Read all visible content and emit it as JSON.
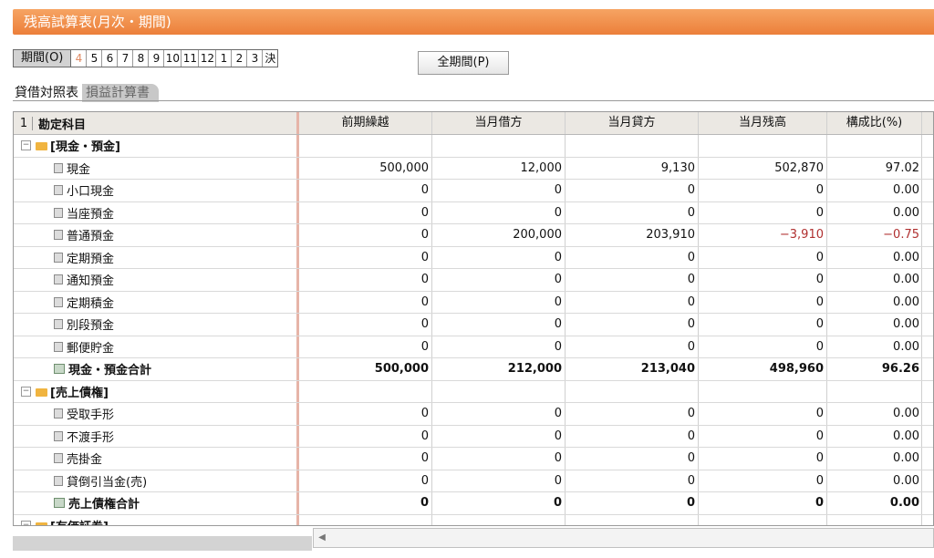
{
  "window": {
    "title": "残高試算表(月次・期間)"
  },
  "period": {
    "label": "期間(O)",
    "buttons": [
      "4",
      "5",
      "6",
      "7",
      "8",
      "9",
      "10",
      "11",
      "12",
      "1",
      "2",
      "3",
      "決"
    ],
    "active_index": 0,
    "all_label": "全期間(P)"
  },
  "tabs": {
    "balance_sheet": "貸借対照表",
    "income_statement": "損益計算書"
  },
  "table": {
    "header_number": "1",
    "headers": [
      "勘定科目",
      "前期繰越",
      "当月借方",
      "当月貸方",
      "当月残高",
      "構成比(%)"
    ],
    "rows": [
      {
        "type": "category",
        "name": "[現金・預金]",
        "values": [
          "",
          "",
          "",
          "",
          ""
        ]
      },
      {
        "type": "account",
        "name": "現金",
        "values": [
          "500,000",
          "12,000",
          "9,130",
          "502,870",
          "97.02"
        ]
      },
      {
        "type": "account",
        "name": "小口現金",
        "values": [
          "0",
          "0",
          "0",
          "0",
          "0.00"
        ]
      },
      {
        "type": "account",
        "name": "当座預金",
        "values": [
          "0",
          "0",
          "0",
          "0",
          "0.00"
        ]
      },
      {
        "type": "account",
        "name": "普通預金",
        "values": [
          "0",
          "200,000",
          "203,910",
          "−3,910",
          "−0.75"
        ]
      },
      {
        "type": "account",
        "name": "定期預金",
        "values": [
          "0",
          "0",
          "0",
          "0",
          "0.00"
        ]
      },
      {
        "type": "account",
        "name": "通知預金",
        "values": [
          "0",
          "0",
          "0",
          "0",
          "0.00"
        ]
      },
      {
        "type": "account",
        "name": "定期積金",
        "values": [
          "0",
          "0",
          "0",
          "0",
          "0.00"
        ]
      },
      {
        "type": "account",
        "name": "別段預金",
        "values": [
          "0",
          "0",
          "0",
          "0",
          "0.00"
        ]
      },
      {
        "type": "account",
        "name": "郵便貯金",
        "values": [
          "0",
          "0",
          "0",
          "0",
          "0.00"
        ]
      },
      {
        "type": "subtotal",
        "name": "現金・預金合計",
        "values": [
          "500,000",
          "212,000",
          "213,040",
          "498,960",
          "96.26"
        ]
      },
      {
        "type": "category",
        "name": "[売上債権]",
        "values": [
          "",
          "",
          "",
          "",
          ""
        ]
      },
      {
        "type": "account",
        "name": "受取手形",
        "values": [
          "0",
          "0",
          "0",
          "0",
          "0.00"
        ]
      },
      {
        "type": "account",
        "name": "不渡手形",
        "values": [
          "0",
          "0",
          "0",
          "0",
          "0.00"
        ]
      },
      {
        "type": "account",
        "name": "売掛金",
        "values": [
          "0",
          "0",
          "0",
          "0",
          "0.00"
        ]
      },
      {
        "type": "account",
        "name": "貸倒引当金(売)",
        "values": [
          "0",
          "0",
          "0",
          "0",
          "0.00"
        ]
      },
      {
        "type": "subtotal",
        "name": "売上債権合計",
        "values": [
          "0",
          "0",
          "0",
          "0",
          "0.00"
        ]
      },
      {
        "type": "category",
        "name": "[有価証券]",
        "values": [
          "",
          "",
          "",
          "",
          ""
        ]
      }
    ]
  },
  "colors": {
    "accent": "#ec7f3a",
    "negative": "#b03030"
  }
}
